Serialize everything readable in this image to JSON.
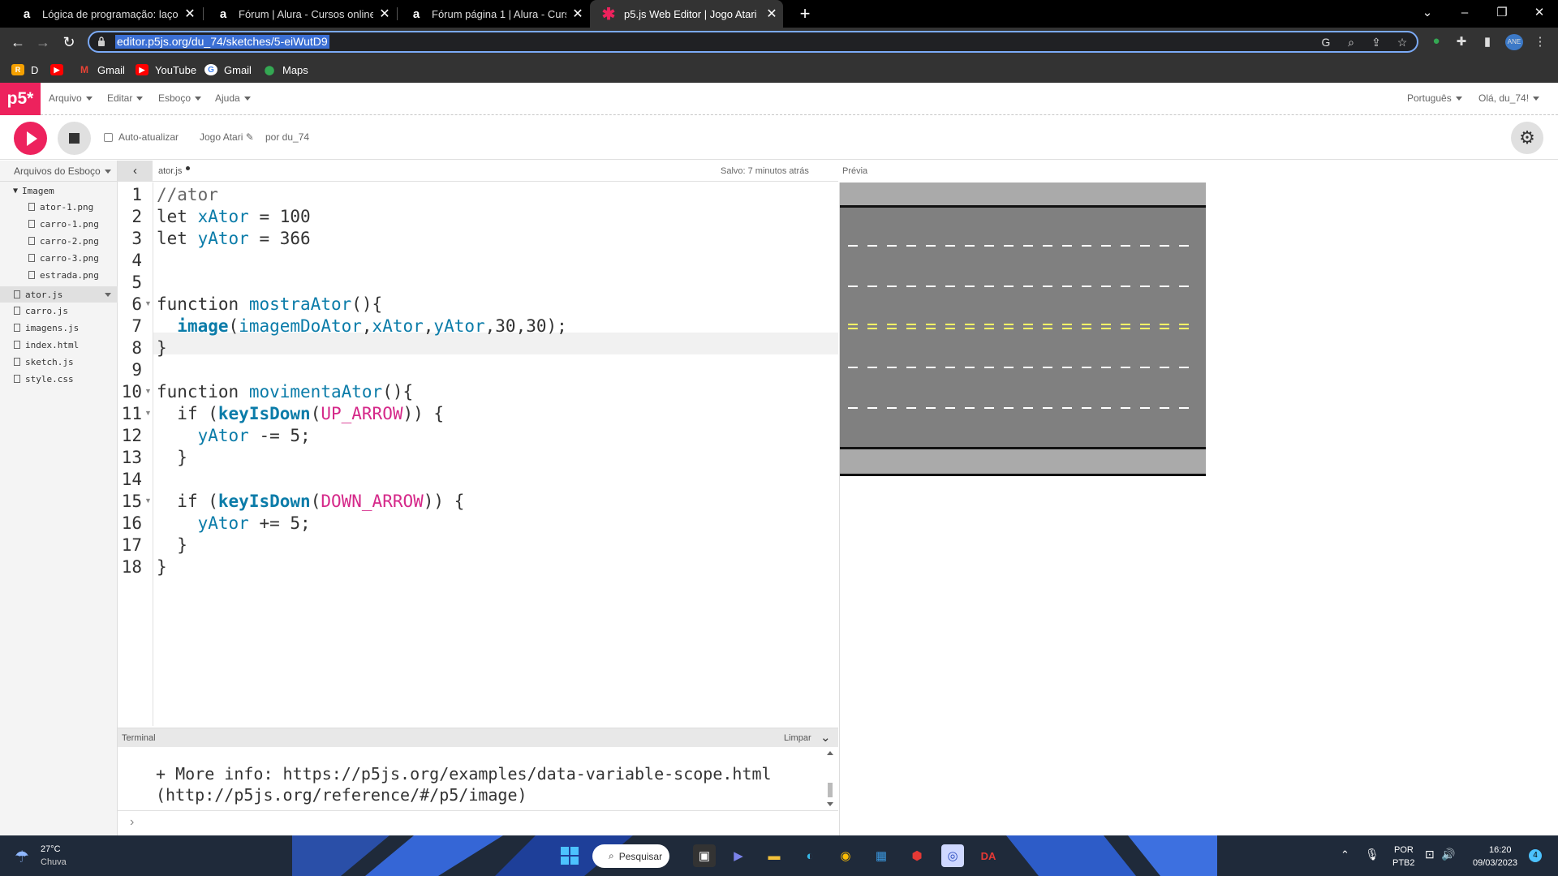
{
  "tabs": [
    {
      "title": "Lógica de programação: laços e l",
      "favicon": "a",
      "active": false
    },
    {
      "title": "Fórum | Alura - Cursos online de",
      "favicon": "a",
      "active": false
    },
    {
      "title": "Fórum página 1 | Alura - Cursos o",
      "favicon": "a",
      "active": false
    },
    {
      "title": "p5.js Web Editor | Jogo Atari",
      "favicon": "✱",
      "active": true
    }
  ],
  "address": {
    "url": "editor.p5js.org/du_74/sketches/5-eiWutD9"
  },
  "profile_badge": "ANE",
  "bookmarks": [
    {
      "label": "D",
      "icon": "R",
      "color": "#f4a000"
    },
    {
      "label": "",
      "icon": "▶",
      "color": "#ff0000"
    },
    {
      "label": "Gmail",
      "icon": "M",
      "color": "#ea4335"
    },
    {
      "label": "YouTube",
      "icon": "▶",
      "color": "#ff0000"
    },
    {
      "label": "Gmail",
      "icon": "G",
      "color": "#4285f4"
    },
    {
      "label": "Maps",
      "icon": "⬤",
      "color": "#34a853"
    }
  ],
  "p5": {
    "logo": "p5*",
    "menus": [
      "Arquivo",
      "Editar",
      "Esboço",
      "Ajuda"
    ],
    "language": "Português",
    "greeting": "Olá, du_74!",
    "auto_refresh": "Auto-atualizar",
    "sketch_name": "Jogo Atari",
    "by_user": "por du_74",
    "sidebar_title": "Arquivos do Esboço",
    "folder": "Imagem",
    "folder_files": [
      "ator-1.png",
      "carro-1.png",
      "carro-2.png",
      "carro-3.png",
      "estrada.png"
    ],
    "root_files": [
      "ator.js",
      "carro.js",
      "imagens.js",
      "index.html",
      "sketch.js",
      "style.css"
    ],
    "open_file": "ator.js",
    "saved_status": "Salvo: 7 minutos atrás",
    "preview_label": "Prévia",
    "terminal_title": "Terminal",
    "terminal_clear": "Limpar",
    "terminal_lines": [
      "+ More info: https://p5js.org/examples/data-variable-scope.html",
      "(http://p5js.org/reference/#/p5/image)"
    ],
    "prompt": "›"
  },
  "code_lines": [
    "//ator",
    "let xAtor = 100",
    "let yAtor = 366",
    "",
    "",
    "function mostraAtor(){",
    "  image(imagemDoAtor,xAtor,yAtor,30,30);",
    "}",
    "",
    "function movimentaAtor(){",
    "  if (keyIsDown(UP_ARROW)) {",
    "    yAtor -= 5;",
    "  }",
    "",
    "  if (keyIsDown(DOWN_ARROW)) {",
    "    yAtor += 5;",
    "  }",
    "}"
  ],
  "line_numbers": [
    "1",
    "2",
    "3",
    "4",
    "5",
    "6",
    "7",
    "8",
    "9",
    "10",
    "11",
    "12",
    "13",
    "14",
    "15",
    "16",
    "17",
    "18"
  ],
  "colors": {
    "p5_pink": "#ed225d",
    "road": "#808080",
    "road_edge": "#aaaaaa",
    "lane_white": "#ffffff",
    "lane_yellow": "#ffff66"
  },
  "taskbar": {
    "weather_temp": "27°C",
    "weather_desc": "Chuva",
    "search": "Pesquisar",
    "lang_top": "POR",
    "lang_bottom": "PTB2",
    "time": "16:20",
    "date": "09/03/2023",
    "notif_count": "4"
  }
}
